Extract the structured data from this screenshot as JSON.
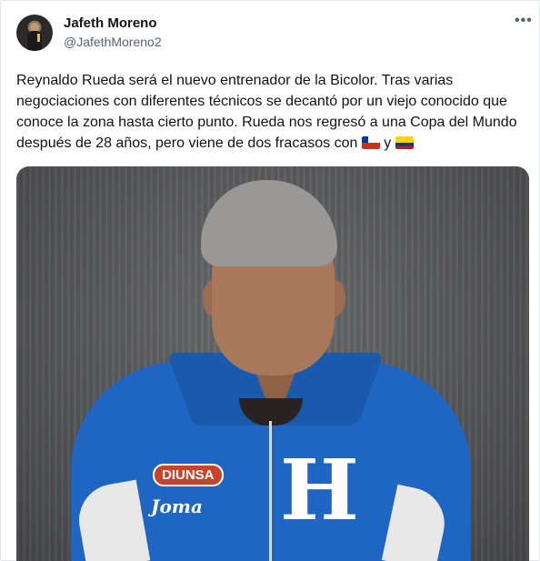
{
  "tweet": {
    "author_name": "Jafeth Moreno",
    "author_handle": "@JafethMoreno2",
    "more_icon": "more-horizontal-icon",
    "text_main": "Reynaldo Rueda será el nuevo  entrenador de la Bicolor. Tras varias negociaciones con diferentes técnicos se decantó por un viejo conocido que conoce la zona hasta cierto punto. Rueda nos regresó a una Copa del Mundo después de 28 años, pero viene de dos fracasos con ",
    "text_conjunction": " y ",
    "flags": [
      "chile-flag-icon",
      "colombia-flag-icon"
    ]
  },
  "photo": {
    "sponsor_badge": "DIUNSA",
    "brand_badge": "Joma",
    "chest_letter": "H"
  },
  "colors": {
    "text": "#0f1419",
    "muted": "#536471",
    "jacket_blue": "#1f66c3"
  }
}
